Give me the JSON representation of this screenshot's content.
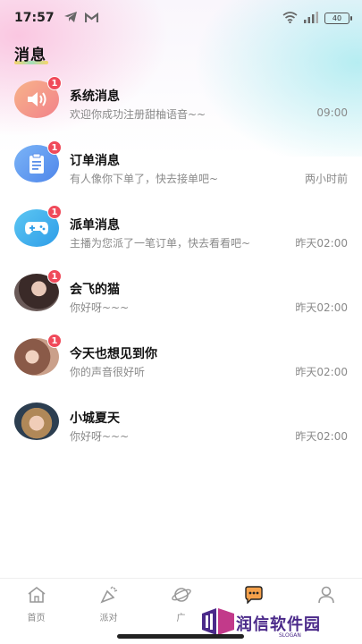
{
  "status_bar": {
    "time": "17:57",
    "battery": "40"
  },
  "page": {
    "title": "消息"
  },
  "messages": [
    {
      "name": "系统消息",
      "preview": "欢迎你成功注册甜柚语音~~",
      "time": "09:00",
      "badge": "1",
      "avatar": "speaker-icon",
      "color": "#f5a06a"
    },
    {
      "name": "订单消息",
      "preview": "有人像你下单了，快去接单吧~",
      "time": "两小时前",
      "badge": "1",
      "avatar": "order-clipboard-icon",
      "color": "#5a9cf2"
    },
    {
      "name": "派单消息",
      "preview": "主播为您派了一笔订单，快去看看吧~",
      "time": "昨天02:00",
      "badge": "1",
      "avatar": "gamepad-icon",
      "color": "#43b4ee"
    },
    {
      "name": "会飞的猫",
      "preview": "你好呀~~~",
      "time": "昨天02:00",
      "badge": "1",
      "avatar": "user-photo"
    },
    {
      "name": "今天也想见到你",
      "preview": "你的声音很好听",
      "time": "昨天02:00",
      "badge": "1",
      "avatar": "user-photo"
    },
    {
      "name": "小城夏天",
      "preview": "你好呀~~~",
      "time": "昨天02:00",
      "badge": "",
      "avatar": "user-photo"
    }
  ],
  "tabs": [
    {
      "label": "首页",
      "icon": "home-icon"
    },
    {
      "label": "派对",
      "icon": "party-icon"
    },
    {
      "label": "广",
      "icon": "planet-icon"
    },
    {
      "label": "",
      "icon": "message-icon",
      "active": true
    },
    {
      "label": "",
      "icon": "profile-icon"
    }
  ],
  "watermark": {
    "text": "润信软件园",
    "slogan": "SLOGAN"
  }
}
